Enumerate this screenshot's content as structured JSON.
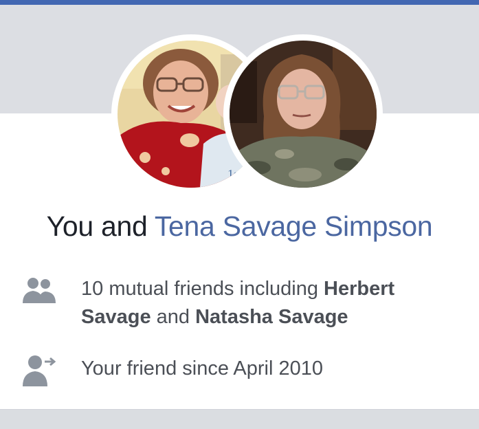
{
  "colors": {
    "top_bar": "#4267b2",
    "cover": "#dcdee3",
    "card": "#ffffff",
    "link_name": "#4b67a1",
    "text_dark": "#1d2129",
    "text_body": "#4b4f56",
    "icon_gray": "#8d949e"
  },
  "profile": {
    "left_avatar_alt": "profile photo",
    "right_avatar_alt": "profile photo"
  },
  "headline": {
    "prefix": "You and",
    "friend_name": "Tena Savage Simpson"
  },
  "mutual_friends": {
    "icon": "friends-icon",
    "text_prefix": "10 mutual friends including",
    "friend_1": "Herbert Savage",
    "joiner": "and",
    "friend_2": "Natasha Savage"
  },
  "friendship": {
    "icon": "friend-since-icon",
    "text": "Your friend since April 2010"
  }
}
